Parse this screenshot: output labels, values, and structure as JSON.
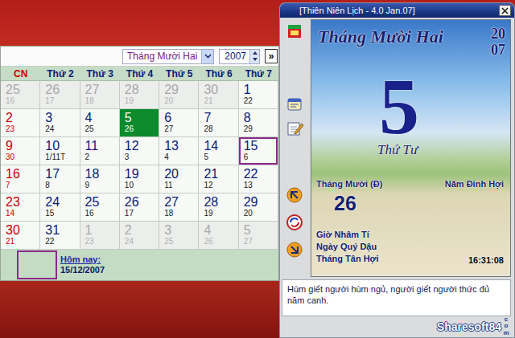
{
  "calendar": {
    "month_select": {
      "value": "Tháng Mười Hai"
    },
    "year_field": {
      "value": "2007"
    },
    "expand_button": "»",
    "weekdays": [
      {
        "label": "CN",
        "color": "#cc0000"
      },
      {
        "label": "Thứ 2",
        "color": "#0a1a78"
      },
      {
        "label": "Thứ 3",
        "color": "#0a1a78"
      },
      {
        "label": "Thứ 4",
        "color": "#0a1a78"
      },
      {
        "label": "Thứ 5",
        "color": "#0a1a78"
      },
      {
        "label": "Thứ 6",
        "color": "#0a1a78"
      },
      {
        "label": "Thứ 7",
        "color": "#0a1a78"
      }
    ],
    "weeks": [
      [
        {
          "solar": "25",
          "lunar": "16",
          "other_month": true,
          "selected": false,
          "today": false
        },
        {
          "solar": "26",
          "lunar": "17",
          "other_month": true,
          "selected": false,
          "today": false
        },
        {
          "solar": "27",
          "lunar": "18",
          "other_month": true,
          "selected": false,
          "today": false
        },
        {
          "solar": "28",
          "lunar": "19",
          "other_month": true,
          "selected": false,
          "today": false
        },
        {
          "solar": "29",
          "lunar": "20",
          "other_month": true,
          "selected": false,
          "today": false
        },
        {
          "solar": "30",
          "lunar": "21",
          "other_month": true,
          "selected": false,
          "today": false
        },
        {
          "solar": "1",
          "lunar": "22",
          "other_month": false,
          "selected": false,
          "today": false
        }
      ],
      [
        {
          "solar": "2",
          "lunar": "23",
          "other_month": false,
          "selected": false,
          "today": false
        },
        {
          "solar": "3",
          "lunar": "24",
          "other_month": false,
          "selected": false,
          "today": false
        },
        {
          "solar": "4",
          "lunar": "25",
          "other_month": false,
          "selected": false,
          "today": false
        },
        {
          "solar": "5",
          "lunar": "26",
          "other_month": false,
          "selected": true,
          "today": false
        },
        {
          "solar": "6",
          "lunar": "27",
          "other_month": false,
          "selected": false,
          "today": false
        },
        {
          "solar": "7",
          "lunar": "28",
          "other_month": false,
          "selected": false,
          "today": false
        },
        {
          "solar": "8",
          "lunar": "29",
          "other_month": false,
          "selected": false,
          "today": false
        }
      ],
      [
        {
          "solar": "9",
          "lunar": "30",
          "other_month": false,
          "selected": false,
          "today": false
        },
        {
          "solar": "10",
          "lunar": "1/11T",
          "other_month": false,
          "selected": false,
          "today": false
        },
        {
          "solar": "11",
          "lunar": "2",
          "other_month": false,
          "selected": false,
          "today": false
        },
        {
          "solar": "12",
          "lunar": "3",
          "other_month": false,
          "selected": false,
          "today": false
        },
        {
          "solar": "13",
          "lunar": "4",
          "other_month": false,
          "selected": false,
          "today": false
        },
        {
          "solar": "14",
          "lunar": "5",
          "other_month": false,
          "selected": false,
          "today": false
        },
        {
          "solar": "15",
          "lunar": "6",
          "other_month": false,
          "selected": false,
          "today": true
        }
      ],
      [
        {
          "solar": "16",
          "lunar": "7",
          "other_month": false,
          "selected": false,
          "today": false
        },
        {
          "solar": "17",
          "lunar": "8",
          "other_month": false,
          "selected": false,
          "today": false
        },
        {
          "solar": "18",
          "lunar": "9",
          "other_month": false,
          "selected": false,
          "today": false
        },
        {
          "solar": "19",
          "lunar": "10",
          "other_month": false,
          "selected": false,
          "today": false
        },
        {
          "solar": "20",
          "lunar": "11",
          "other_month": false,
          "selected": false,
          "today": false
        },
        {
          "solar": "21",
          "lunar": "12",
          "other_month": false,
          "selected": false,
          "today": false
        },
        {
          "solar": "22",
          "lunar": "13",
          "other_month": false,
          "selected": false,
          "today": false
        }
      ],
      [
        {
          "solar": "23",
          "lunar": "14",
          "other_month": false,
          "selected": false,
          "today": false
        },
        {
          "solar": "24",
          "lunar": "15",
          "other_month": false,
          "selected": false,
          "today": false
        },
        {
          "solar": "25",
          "lunar": "16",
          "other_month": false,
          "selected": false,
          "today": false
        },
        {
          "solar": "26",
          "lunar": "17",
          "other_month": false,
          "selected": false,
          "today": false
        },
        {
          "solar": "27",
          "lunar": "18",
          "other_month": false,
          "selected": false,
          "today": false
        },
        {
          "solar": "28",
          "lunar": "19",
          "other_month": false,
          "selected": false,
          "today": false
        },
        {
          "solar": "29",
          "lunar": "20",
          "other_month": false,
          "selected": false,
          "today": false
        }
      ],
      [
        {
          "solar": "30",
          "lunar": "21",
          "other_month": false,
          "selected": false,
          "today": false
        },
        {
          "solar": "31",
          "lunar": "22",
          "other_month": false,
          "selected": false,
          "today": false
        },
        {
          "solar": "1",
          "lunar": "23",
          "other_month": true,
          "selected": false,
          "today": false
        },
        {
          "solar": "2",
          "lunar": "24",
          "other_month": true,
          "selected": false,
          "today": false
        },
        {
          "solar": "3",
          "lunar": "25",
          "other_month": true,
          "selected": false,
          "today": false
        },
        {
          "solar": "4",
          "lunar": "26",
          "other_month": true,
          "selected": false,
          "today": false
        },
        {
          "solar": "5",
          "lunar": "27",
          "other_month": true,
          "selected": false,
          "today": false
        }
      ]
    ],
    "today": {
      "label": "Hôm nay:",
      "date": "15/12/2007"
    }
  },
  "window": {
    "title": "[Thiên Niên Lịch - 4.0 Jan.07]"
  },
  "day_view": {
    "month_title": "Tháng Mười Hai",
    "year": "2007",
    "day": "5",
    "weekday": "Thứ Tư",
    "lunar_month": "Tháng Mười (Đ)",
    "lunar_year": "Năm Đinh Hợi",
    "lunar_day": "26",
    "can_chi": [
      "Giờ Nhâm Tí",
      "Ngày Quý Dậu",
      "Tháng Tân Hợi"
    ],
    "clock": "16:31:08"
  },
  "proverb": "Hùm giết người hùm ngủ, người giết người thức đủ năm canh.",
  "watermark": {
    "name": "Sharesoft84",
    "suffix": "com"
  }
}
